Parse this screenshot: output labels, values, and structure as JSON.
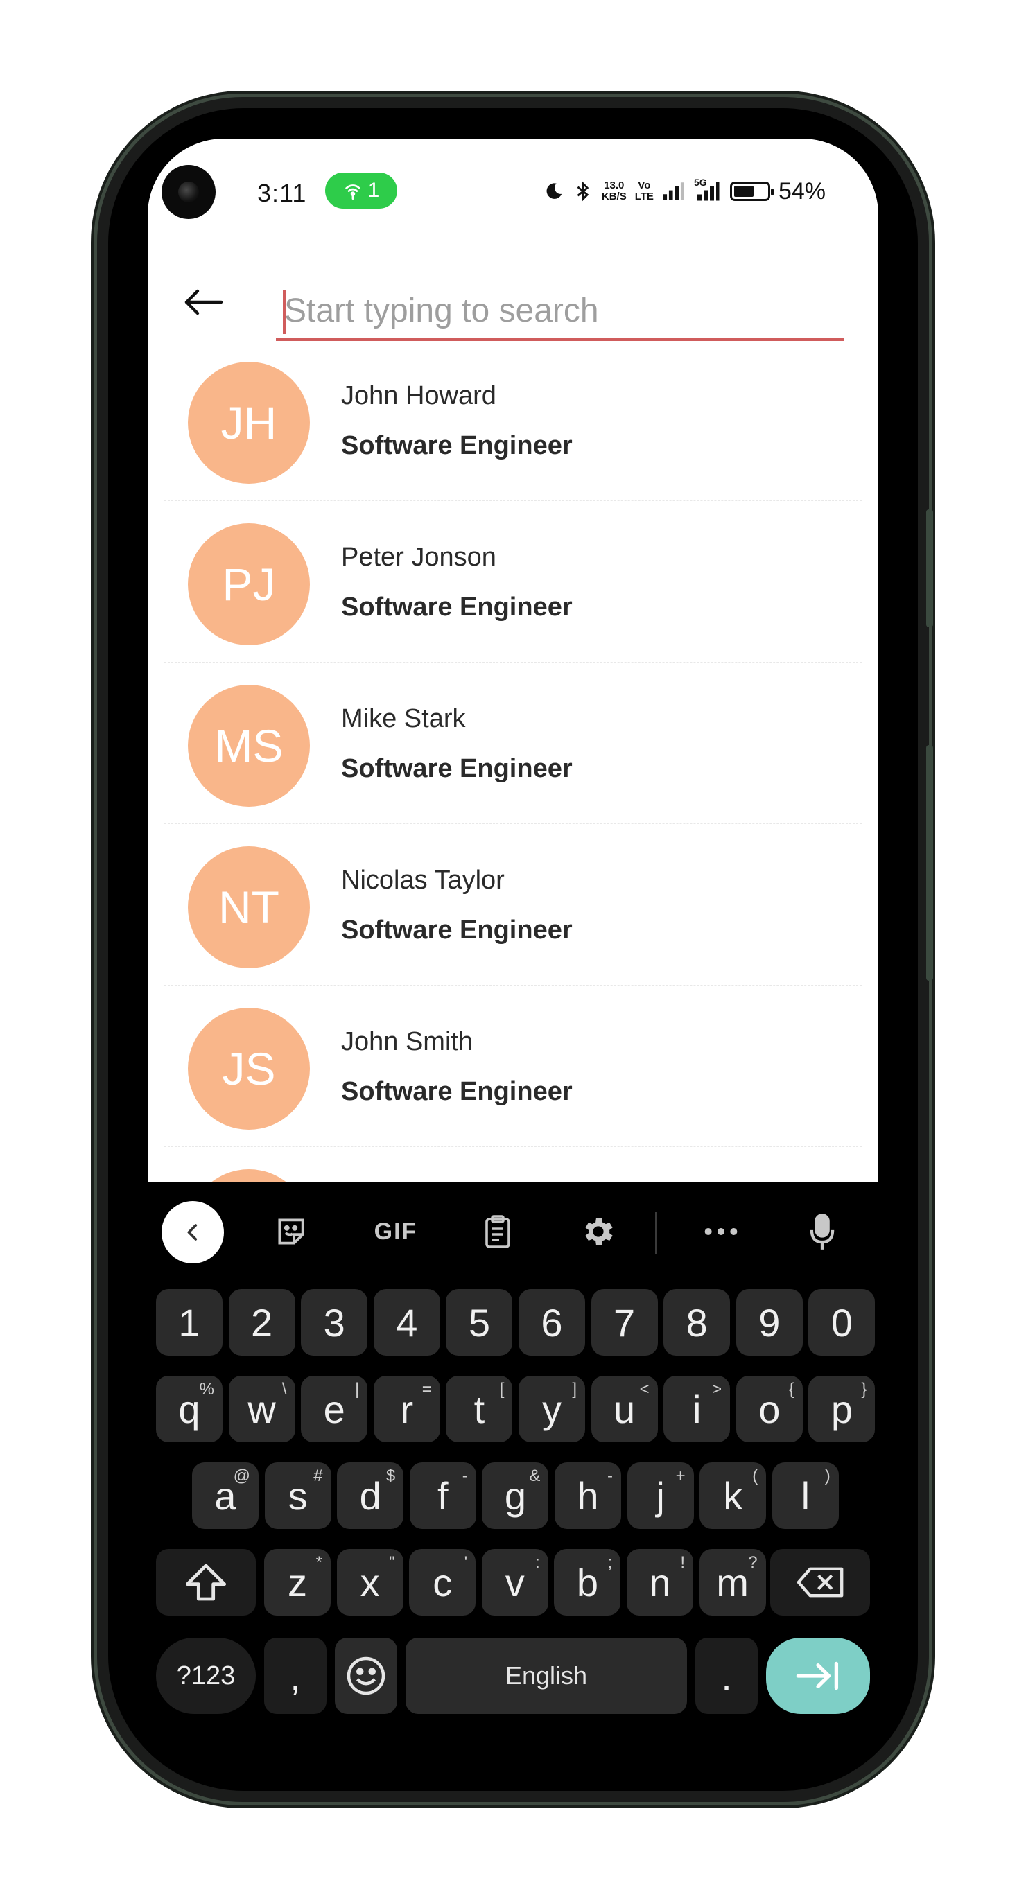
{
  "status_bar": {
    "time": "3:11",
    "hotspot_count": "1",
    "net_speed_top": "13.0",
    "net_speed_bottom": "KB/S",
    "volte_top": "Vo",
    "volte_bottom": "LTE",
    "network": "5G",
    "battery_percent": "54%",
    "battery_level": 0.54,
    "hotspot_color": "#2ecc4a"
  },
  "search": {
    "placeholder": "Start typing to search",
    "value": "",
    "underline_color": "#d05c5c"
  },
  "contacts": [
    {
      "initials": "JH",
      "name": "John Howard",
      "role": "Software Engineer"
    },
    {
      "initials": "PJ",
      "name": "Peter Jonson",
      "role": "Software Engineer"
    },
    {
      "initials": "MS",
      "name": "Mike Stark",
      "role": "Software Engineer"
    },
    {
      "initials": "NT",
      "name": "Nicolas Taylor",
      "role": "Software Engineer"
    },
    {
      "initials": "JS",
      "name": "John Smith",
      "role": "Software Engineer"
    }
  ],
  "avatar_color": "#f9b68a",
  "keyboard": {
    "toolbar": {
      "gif_label": "GIF",
      "icons": [
        "chevron-left-icon",
        "sticker-icon",
        "gif-icon",
        "clipboard-icon",
        "gear-icon",
        "more-icon",
        "microphone-icon"
      ]
    },
    "number_row": [
      "1",
      "2",
      "3",
      "4",
      "5",
      "6",
      "7",
      "8",
      "9",
      "0"
    ],
    "row1": [
      {
        "key": "q",
        "sup": "%"
      },
      {
        "key": "w",
        "sup": "\\"
      },
      {
        "key": "e",
        "sup": "|"
      },
      {
        "key": "r",
        "sup": "="
      },
      {
        "key": "t",
        "sup": "["
      },
      {
        "key": "y",
        "sup": "]"
      },
      {
        "key": "u",
        "sup": "<"
      },
      {
        "key": "i",
        "sup": ">"
      },
      {
        "key": "o",
        "sup": "{"
      },
      {
        "key": "p",
        "sup": "}"
      }
    ],
    "row2": [
      {
        "key": "a",
        "sup": "@"
      },
      {
        "key": "s",
        "sup": "#"
      },
      {
        "key": "d",
        "sup": "$"
      },
      {
        "key": "f",
        "sup": "-"
      },
      {
        "key": "g",
        "sup": "&"
      },
      {
        "key": "h",
        "sup": "-"
      },
      {
        "key": "j",
        "sup": "+"
      },
      {
        "key": "k",
        "sup": "("
      },
      {
        "key": "l",
        "sup": ")"
      }
    ],
    "row3": [
      {
        "key": "z",
        "sup": "*"
      },
      {
        "key": "x",
        "sup": "\""
      },
      {
        "key": "c",
        "sup": "'"
      },
      {
        "key": "v",
        "sup": ":"
      },
      {
        "key": "b",
        "sup": ";"
      },
      {
        "key": "n",
        "sup": "!"
      },
      {
        "key": "m",
        "sup": "?"
      }
    ],
    "symbols_label": "?123",
    "comma_label": ",",
    "space_label": "English",
    "period_label": ".",
    "enter_color": "#7ecfc6"
  }
}
